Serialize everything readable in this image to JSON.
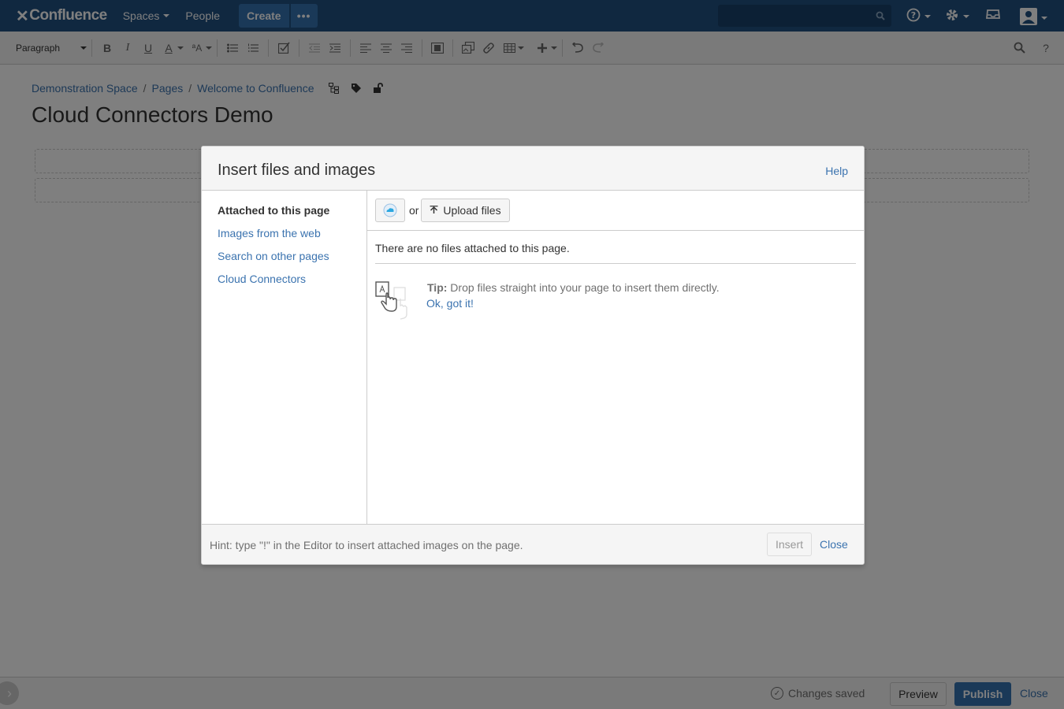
{
  "header": {
    "logo_text": "Confluence",
    "nav": {
      "spaces": "Spaces",
      "people": "People"
    },
    "create_label": "Create",
    "more_label": "•••"
  },
  "toolbar": {
    "paragraph": "Paragraph",
    "bold": "B",
    "italic": "I",
    "underline": "U",
    "text_color": "A",
    "text_size": "ªA"
  },
  "breadcrumbs": [
    "Demonstration Space",
    "Pages",
    "Welcome to Confluence"
  ],
  "page": {
    "title": "Cloud Connectors Demo"
  },
  "dialog": {
    "title": "Insert files and images",
    "help": "Help",
    "nav": [
      "Attached to this page",
      "Images from the web",
      "Search on other pages",
      "Cloud Connectors"
    ],
    "or_text": "or",
    "upload_label": "Upload files",
    "empty_message": "There are no files attached to this page.",
    "tip_label": "Tip:",
    "tip_text": " Drop files straight into your page to insert them directly.",
    "tip_ack": "Ok, got it!",
    "hint": "Hint: type \"!\" in the Editor to insert attached images on the page.",
    "insert_label": "Insert",
    "close_label": "Close"
  },
  "footer": {
    "status": "Changes saved",
    "preview": "Preview",
    "publish": "Publish",
    "close": "Close"
  },
  "colors": {
    "header_bg": "#205081",
    "accent": "#3572b0",
    "link": "#3b73af"
  }
}
